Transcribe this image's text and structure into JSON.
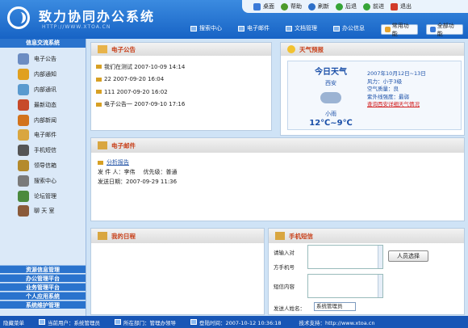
{
  "header": {
    "title": "致力协同办公系统",
    "url": "HTTP://WWW.XTOA.CN"
  },
  "topbar": [
    {
      "label": "桌面",
      "icon": "desktop-icon",
      "color": "#3a7ad8"
    },
    {
      "label": "帮助",
      "icon": "help-icon",
      "color": "#4c9a2a"
    },
    {
      "label": "刷新",
      "icon": "refresh-icon",
      "color": "#2d6fc8"
    },
    {
      "label": "后退",
      "icon": "back-icon",
      "color": "#35a437"
    },
    {
      "label": "前进",
      "icon": "forward-icon",
      "color": "#35a437"
    },
    {
      "label": "退出",
      "icon": "exit-icon",
      "color": "#d23b2a"
    }
  ],
  "nav": [
    {
      "label": "搜索中心",
      "icon": "search-center-icon"
    },
    {
      "label": "电子邮件",
      "icon": "email-icon"
    },
    {
      "label": "文档管理",
      "icon": "document-icon"
    },
    {
      "label": "办公信息",
      "icon": "office-info-icon"
    }
  ],
  "buttons": {
    "common": "常用功能",
    "all": "全部功能"
  },
  "sidebar": {
    "header": "信息交流系统",
    "items": [
      {
        "label": "电子公告",
        "icon": "bulletin-icon",
        "color": "#6b8cc2"
      },
      {
        "label": "内部通知",
        "icon": "notice-icon",
        "color": "#e0a020"
      },
      {
        "label": "内部通讯",
        "icon": "communication-icon",
        "color": "#5a9acf"
      },
      {
        "label": "最新动态",
        "icon": "news-icon",
        "color": "#c74a2a"
      },
      {
        "label": "内部新闻",
        "icon": "internal-news-icon",
        "color": "#d2731c"
      },
      {
        "label": "电子邮件",
        "icon": "mail-icon",
        "color": "#d9a640"
      },
      {
        "label": "手机短信",
        "icon": "sms-icon",
        "color": "#555555"
      },
      {
        "label": "领导信箱",
        "icon": "leader-mailbox-icon",
        "color": "#b48a2c"
      },
      {
        "label": "搜索中心",
        "icon": "search-icon",
        "color": "#7a7a7a"
      },
      {
        "label": "论坛管理",
        "icon": "forum-icon",
        "color": "#4b8a3e"
      },
      {
        "label": "聊 天 室",
        "icon": "chat-icon",
        "color": "#8a5a3a"
      }
    ],
    "categories": [
      "资源信息管理",
      "办公管理平台",
      "业务管理平台",
      "个人应用系统",
      "系统维护管理"
    ]
  },
  "bulletin": {
    "title": "电子公告",
    "items": [
      "我们在测试 2007-10-09 14:14",
      "22 2007-09-20 16:04",
      "111 2007-09-20 16:02",
      "电子公告一 2007-09-10 17:16"
    ]
  },
  "weather": {
    "title": "天气预报",
    "heading": "今日天气",
    "city": "西安",
    "condition": "小雨",
    "temp": "12℃~9℃",
    "date": "2007年10月12日~13日",
    "wind": "风力：小于3级",
    "air": "空气质量：良",
    "uv": "紫外线强度：最弱",
    "link": "查询西安详细天气情况"
  },
  "email": {
    "title": "电子邮件",
    "subject": "分析报告",
    "sender": "发 件 人：李伟",
    "priority": "优先级：普通",
    "date": "发送日期：2007-09-29 11:36"
  },
  "schedule": {
    "title": "我的日程"
  },
  "sms": {
    "title": "手机短信",
    "to_label_1": "请输入对",
    "to_label_2": "方手机号",
    "content_label": "短信内容",
    "sender_label": "发送人姓名：",
    "sender_value": "系统管理员",
    "select_button": "人员选择"
  },
  "status": {
    "menu": "隐藏菜单",
    "user": "当前用户：系统管理员",
    "dept": "所在部门：管理办领导",
    "login": "登陆时间：2007-10-12 10:36:18",
    "support": "技术支持：http://www.xtoa.cn"
  }
}
